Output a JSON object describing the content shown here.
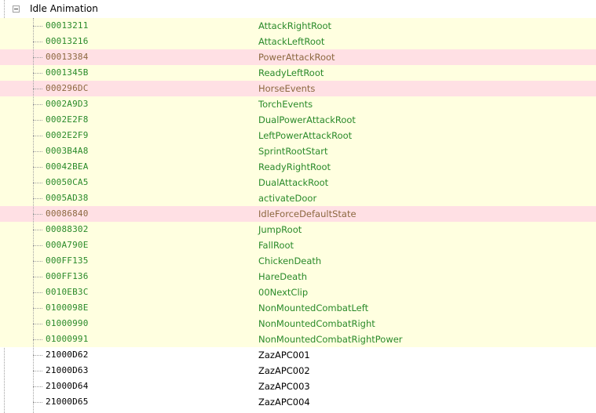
{
  "tree": {
    "group_label": "Idle Animation",
    "rows": [
      {
        "formid": "00013211",
        "name": "AttackRightRoot",
        "bg": "yellow",
        "fg": "green"
      },
      {
        "formid": "00013216",
        "name": "AttackLeftRoot",
        "bg": "yellow",
        "fg": "green"
      },
      {
        "formid": "00013384",
        "name": "PowerAttackRoot",
        "bg": "red",
        "fg": "brown"
      },
      {
        "formid": "0001345B",
        "name": "ReadyLeftRoot",
        "bg": "yellow",
        "fg": "green"
      },
      {
        "formid": "000296DC",
        "name": "HorseEvents",
        "bg": "red",
        "fg": "brown"
      },
      {
        "formid": "0002A9D3",
        "name": "TorchEvents",
        "bg": "yellow",
        "fg": "green"
      },
      {
        "formid": "0002E2F8",
        "name": "DualPowerAttackRoot",
        "bg": "yellow",
        "fg": "green"
      },
      {
        "formid": "0002E2F9",
        "name": "LeftPowerAttackRoot",
        "bg": "yellow",
        "fg": "green"
      },
      {
        "formid": "0003B4A8",
        "name": "SprintRootStart",
        "bg": "yellow",
        "fg": "green"
      },
      {
        "formid": "00042BEA",
        "name": "ReadyRightRoot",
        "bg": "yellow",
        "fg": "green"
      },
      {
        "formid": "00050CA5",
        "name": "DualAttackRoot",
        "bg": "yellow",
        "fg": "green"
      },
      {
        "formid": "0005AD38",
        "name": "activateDoor",
        "bg": "yellow",
        "fg": "green"
      },
      {
        "formid": "00086840",
        "name": "IdleForceDefaultState",
        "bg": "red",
        "fg": "brown"
      },
      {
        "formid": "00088302",
        "name": "JumpRoot",
        "bg": "yellow",
        "fg": "green"
      },
      {
        "formid": "000A790E",
        "name": "FallRoot",
        "bg": "yellow",
        "fg": "green"
      },
      {
        "formid": "000FF135",
        "name": "ChickenDeath",
        "bg": "yellow",
        "fg": "green"
      },
      {
        "formid": "000FF136",
        "name": "HareDeath",
        "bg": "yellow",
        "fg": "green"
      },
      {
        "formid": "0010EB3C",
        "name": "00NextClip",
        "bg": "yellow",
        "fg": "green"
      },
      {
        "formid": "0100098E",
        "name": "NonMountedCombatLeft",
        "bg": "yellow",
        "fg": "green"
      },
      {
        "formid": "01000990",
        "name": "NonMountedCombatRight",
        "bg": "yellow",
        "fg": "green"
      },
      {
        "formid": "01000991",
        "name": "NonMountedCombatRightPower",
        "bg": "yellow",
        "fg": "green"
      },
      {
        "formid": "21000D62",
        "name": "ZazAPC001",
        "bg": "white",
        "fg": "black"
      },
      {
        "formid": "21000D63",
        "name": "ZazAPC002",
        "bg": "white",
        "fg": "black"
      },
      {
        "formid": "21000D64",
        "name": "ZazAPC003",
        "bg": "white",
        "fg": "black"
      },
      {
        "formid": "21000D65",
        "name": "ZazAPC004",
        "bg": "white",
        "fg": "black"
      }
    ]
  },
  "colors": {
    "yellow_bg": "#ffffe0",
    "red_bg": "#ffe0e4",
    "green_text": "#2a8a2a",
    "brown_text": "#8c6840",
    "black_text": "#000000"
  },
  "icons": {
    "expander": "minus-box-icon"
  }
}
